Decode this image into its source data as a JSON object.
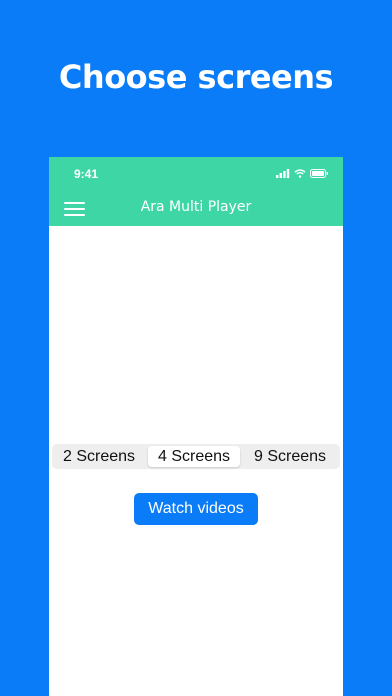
{
  "promo": {
    "headline": "Choose screens"
  },
  "status_bar": {
    "time": "9:41",
    "icons": [
      "signal-icon",
      "wifi-icon",
      "battery-icon"
    ]
  },
  "nav_bar": {
    "title": "Ara Multi Player",
    "menu_icon": "hamburger-menu-icon"
  },
  "screen_selector": {
    "options": [
      "2 Screens",
      "4 Screens",
      "9 Screens"
    ],
    "selected": "4 Screens"
  },
  "watch_button": {
    "label": "Watch videos"
  },
  "colors": {
    "background": "#0b7cf7",
    "nav_bar": "#3fd6a5",
    "button": "#0b7cf7",
    "segment_track": "#eeeeef"
  }
}
